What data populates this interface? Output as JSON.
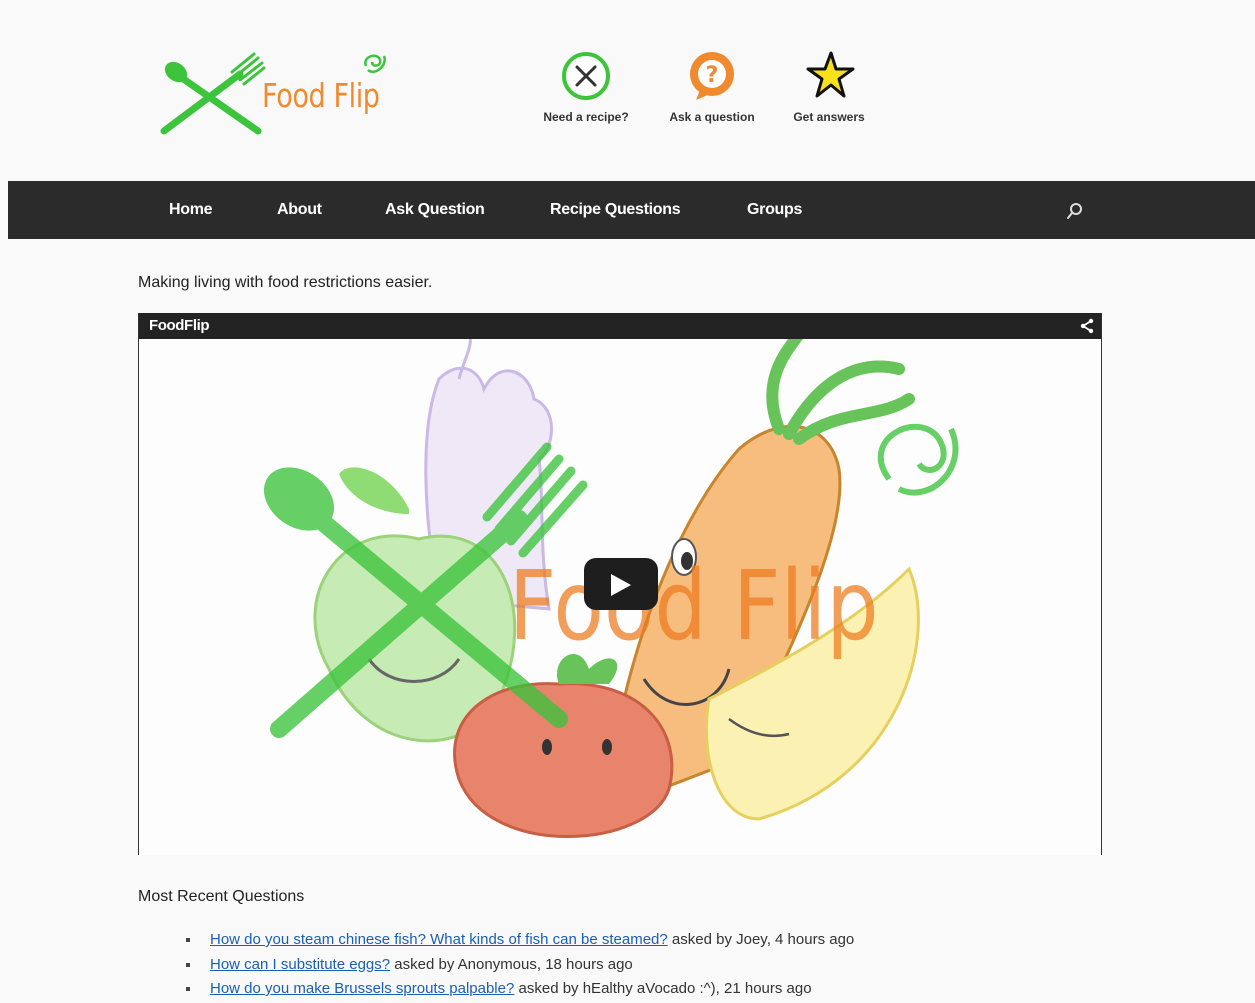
{
  "header": {
    "logo_text": "Food Flip",
    "features": [
      {
        "label": "Need a recipe?",
        "icon": "fork-knife-icon"
      },
      {
        "label": "Ask a question",
        "icon": "question-bubble-icon"
      },
      {
        "label": "Get answers",
        "icon": "star-icon"
      }
    ]
  },
  "nav": {
    "items": [
      {
        "label": "Home"
      },
      {
        "label": "About"
      },
      {
        "label": "Ask Question"
      },
      {
        "label": "Recipe Questions"
      },
      {
        "label": "Groups"
      }
    ],
    "search_icon": "search-icon"
  },
  "tagline": "Making living with food restrictions easier.",
  "video": {
    "title": "FoodFlip",
    "watermark": "Food Flip",
    "share_icon": "share-icon",
    "play_icon": "play-icon"
  },
  "recent": {
    "heading": "Most Recent Questions",
    "questions": [
      {
        "title": "How do you steam chinese fish? What kinds of fish can be steamed?",
        "meta": "asked by Joey, 4 hours ago"
      },
      {
        "title": "How can I substitute eggs?",
        "meta": "asked by Anonymous, 18 hours ago"
      },
      {
        "title": "How do you make Brussels sprouts palpable?",
        "meta": "asked by hEalthy aVocado :^), 21 hours ago"
      }
    ]
  },
  "colors": {
    "brand_green": "#3cc43c",
    "brand_orange": "#f08a2e",
    "nav_bg": "#2b2b2b",
    "link": "#1a5fb4"
  }
}
